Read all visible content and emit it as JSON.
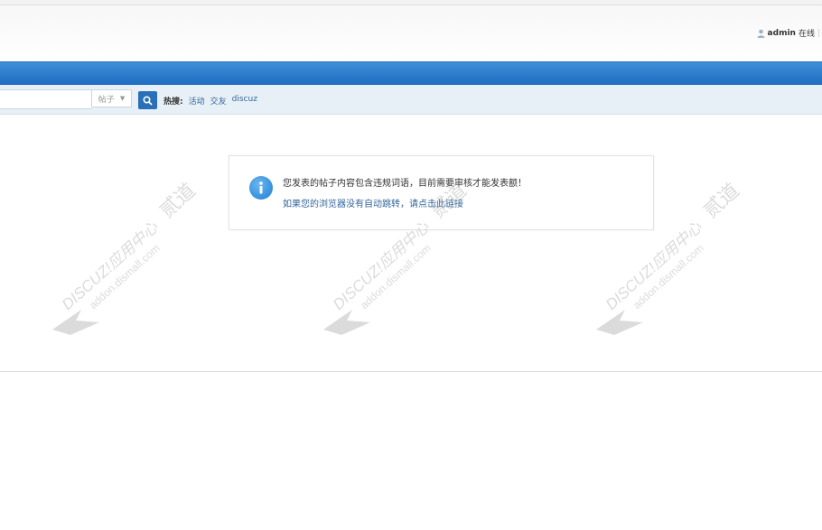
{
  "header": {
    "user": "admin",
    "status": "在线"
  },
  "search": {
    "type_label": "帖子",
    "hot_label": "热搜:",
    "hot_terms": [
      "活动",
      "交友",
      "discuz"
    ]
  },
  "message": {
    "title": "您发表的帖子内容包含违规词语，目前需要审核才能发表额！",
    "redirect_link": "如果您的浏览器没有自动跳转，请点击此链接"
  },
  "watermark": {
    "line1": "DISCUZ!应用中心",
    "line2": "addon.dismall.com",
    "line3": "贰道"
  },
  "colors": {
    "nav_blue": "#1f6cc1",
    "link": "#336699",
    "info_icon": "#1f7fd3"
  }
}
